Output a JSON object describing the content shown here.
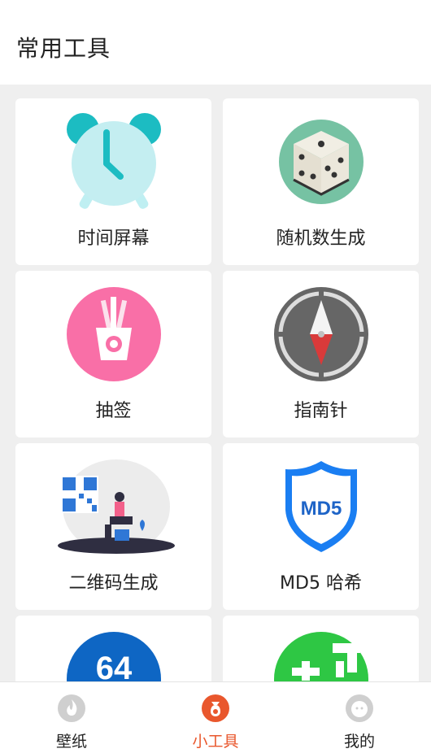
{
  "header": {
    "title": "常用工具"
  },
  "tools": [
    {
      "label": "时间屏幕",
      "icon": "alarm-clock-icon"
    },
    {
      "label": "随机数生成",
      "icon": "dice-icon"
    },
    {
      "label": "抽签",
      "icon": "fortune-sticks-icon"
    },
    {
      "label": "指南针",
      "icon": "compass-icon"
    },
    {
      "label": "二维码生成",
      "icon": "qr-code-icon"
    },
    {
      "label": "MD5 哈希",
      "icon": "md5-shield-icon"
    },
    {
      "label": "",
      "icon": "base64-icon",
      "icon_text": "64"
    },
    {
      "label": "",
      "icon": "green-app-icon"
    }
  ],
  "bottom_nav": {
    "tabs": [
      {
        "label": "壁纸",
        "icon": "flame-icon"
      },
      {
        "label": "小工具",
        "icon": "money-bag-icon",
        "active": true
      },
      {
        "label": "我的",
        "icon": "smile-face-icon"
      }
    ]
  },
  "colors": {
    "accent": "#e9572d",
    "background": "#efefef",
    "card": "#ffffff"
  }
}
